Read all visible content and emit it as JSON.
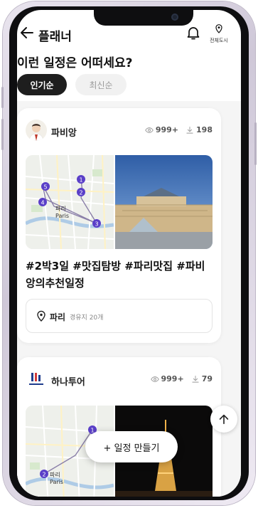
{
  "header": {
    "title": "플래너",
    "location_label": "전체도시"
  },
  "question": "이런 일정은 어떠세요?",
  "sort_tabs": [
    {
      "label": "인기순",
      "active": true
    },
    {
      "label": "최신순",
      "active": false
    }
  ],
  "posts": [
    {
      "author": "파비앙",
      "views": "999+",
      "downloads": "198",
      "title": "#2박3일 #맛집탐방 #파리맛집 #파비앙의추천일정",
      "place": "파리",
      "place_count": "경유지 20개",
      "map_labels": {
        "city_kr": "파리",
        "city_en": "Paris"
      },
      "map_pins": [
        "1",
        "2",
        "3",
        "4",
        "5"
      ]
    },
    {
      "author": "하나투어",
      "views": "999+",
      "downloads": "79",
      "map_labels": {
        "city_kr": "파리",
        "city_en": "Paris"
      },
      "map_pins": [
        "1",
        "2"
      ]
    }
  ],
  "actions": {
    "make_schedule": "+ 일정 만들기"
  },
  "colors": {
    "accent_dark": "#1e1e1e",
    "pin": "#5a3fc8",
    "route": "#8a7fa8"
  }
}
